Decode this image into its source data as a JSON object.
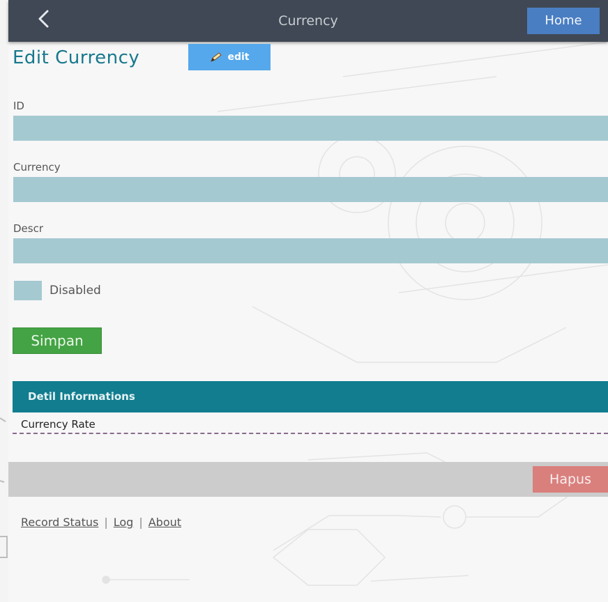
{
  "header": {
    "title": "Currency",
    "home_label": "Home",
    "back_icon": "chevron-left-icon"
  },
  "form": {
    "title": "Edit Currency",
    "edit_badge_label": "edit",
    "edit_badge_icon": "pencil-icon",
    "fields": [
      {
        "label": "ID",
        "value": "",
        "placeholder": ""
      },
      {
        "label": "Currency",
        "value": "",
        "placeholder": ""
      },
      {
        "label": "Descr",
        "value": "",
        "placeholder": ""
      }
    ],
    "disabled_label": "Disabled",
    "disabled_checked": false,
    "save_label": "Simpan"
  },
  "detail": {
    "header": "Detil Informations",
    "items": [
      "Currency Rate"
    ]
  },
  "actions": {
    "delete_label": "Hapus"
  },
  "footer": {
    "links": [
      "Record Status",
      "Log",
      "About"
    ],
    "separator": "|"
  },
  "colors": {
    "topbar": "#3f4854",
    "home_button": "#4a7ec3",
    "title_teal": "#17788d",
    "edit_badge": "#55a8ec",
    "input_bg": "#a5c9d1",
    "save_green": "#44a344",
    "detail_header": "#117d8f",
    "delete_red": "#d9807d",
    "action_bar": "#cccccc"
  }
}
